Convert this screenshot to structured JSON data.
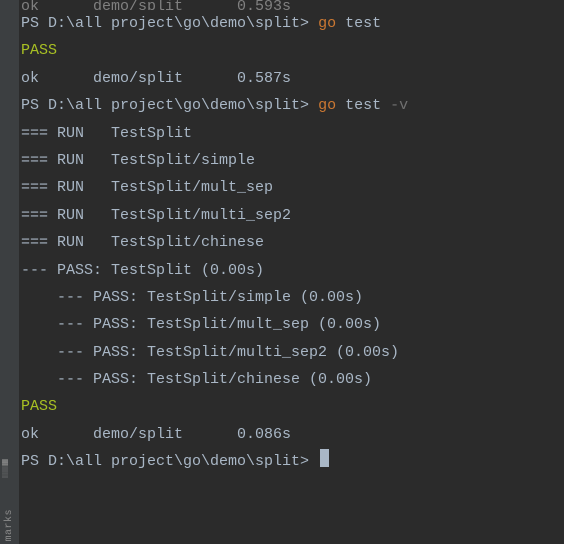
{
  "gutter": {
    "icon1": "▦",
    "icon2": "▒",
    "label": "marks"
  },
  "lines": {
    "l0": {
      "full": "ok      demo/split      0.593s"
    },
    "l1": {
      "prompt": "PS D:\\all project\\go\\demo\\split> ",
      "cmd": "go",
      "args": " test"
    },
    "l2": {
      "full": "PASS"
    },
    "l3": {
      "full": "ok      demo/split      0.587s"
    },
    "l4": {
      "prompt": "PS D:\\all project\\go\\demo\\split> ",
      "cmd": "go",
      "args": " test ",
      "flag": "-v"
    },
    "l5": {
      "full": "=== RUN   TestSplit"
    },
    "l6": {
      "full": "=== RUN   TestSplit/simple"
    },
    "l7": {
      "full": "=== RUN   TestSplit/mult_sep"
    },
    "l8": {
      "full": "=== RUN   TestSplit/multi_sep2"
    },
    "l9": {
      "full": "=== RUN   TestSplit/chinese"
    },
    "l10": {
      "full": "--- PASS: TestSplit (0.00s)"
    },
    "l11": {
      "full": "    --- PASS: TestSplit/simple (0.00s)"
    },
    "l12": {
      "full": "    --- PASS: TestSplit/mult_sep (0.00s)"
    },
    "l13": {
      "full": "    --- PASS: TestSplit/multi_sep2 (0.00s)"
    },
    "l14": {
      "full": "    --- PASS: TestSplit/chinese (0.00s)"
    },
    "l15": {
      "full": "PASS"
    },
    "l16": {
      "full": "ok      demo/split      0.086s"
    },
    "l17": {
      "prompt": "PS D:\\all project\\go\\demo\\split> "
    }
  }
}
